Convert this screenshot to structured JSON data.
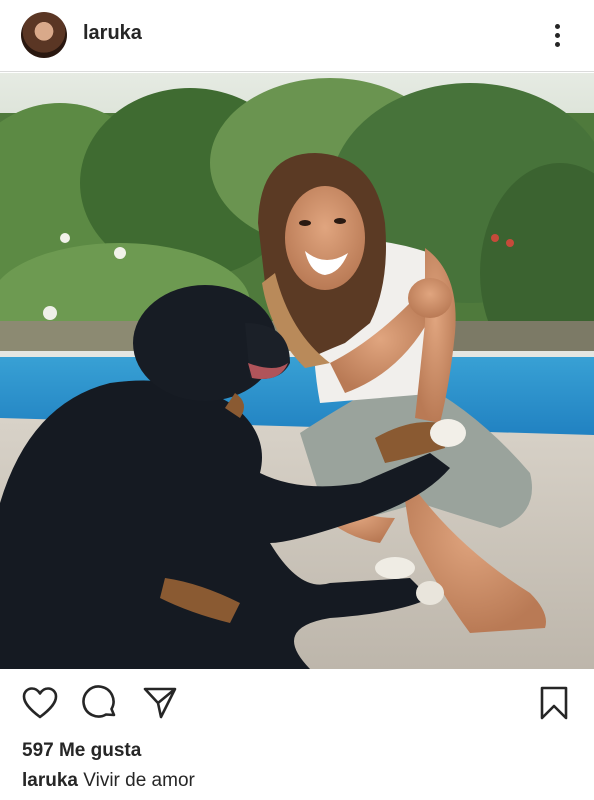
{
  "post": {
    "username": "laruka",
    "avatar_icon": "profile-avatar",
    "more_icon": "more-vertical-icon",
    "likes_text": "597 Me gusta",
    "caption_user": "laruka",
    "caption_text": "Vivir de amor"
  },
  "actions": {
    "like_icon": "heart-icon",
    "comment_icon": "comment-icon",
    "share_icon": "send-icon",
    "save_icon": "bookmark-icon"
  },
  "colors": {
    "text": "#262626",
    "divider": "#dbdbdb",
    "background": "#ffffff"
  }
}
